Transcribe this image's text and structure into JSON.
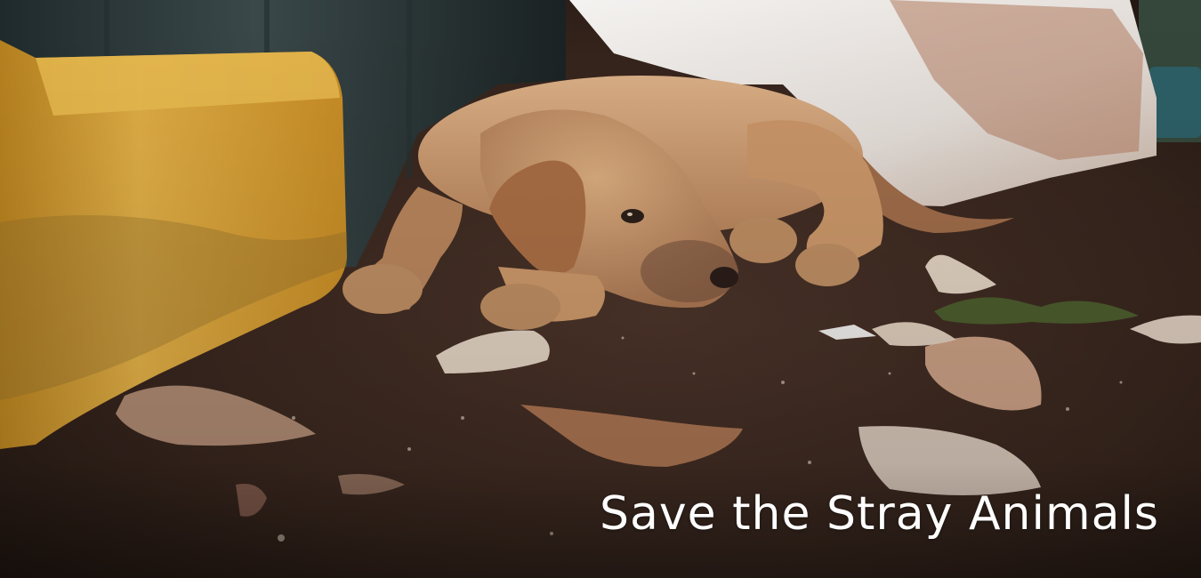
{
  "banner": {
    "caption": "Save the Stray Animals"
  },
  "colors": {
    "soil": "#3a2820",
    "soil_dark": "#241812",
    "barrel": "#2f3a3c",
    "bucket": "#d29a2e",
    "puppy_fur": "#c8976a",
    "tarp": "#e8e4e0",
    "caption_text": "#ffffff"
  }
}
